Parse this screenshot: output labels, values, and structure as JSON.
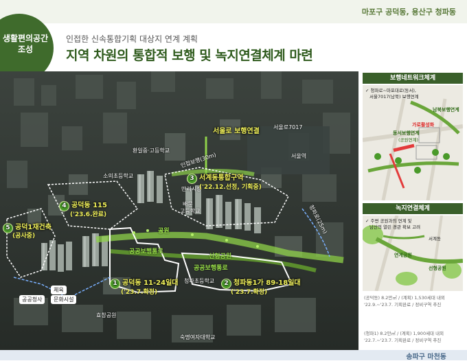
{
  "header": {
    "location": "마포구 공덕동, 용산구 청파동",
    "badge_line1": "생활편의공간",
    "badge_line2": "조성",
    "subtitle": "인접한 신속통합기획 대상지 연계 계획",
    "title": "지역 차원의 통합적 보행 및 녹지연결체계 마련"
  },
  "map": {
    "sites": [
      {
        "num": "1",
        "name": "공덕동 11-24일대",
        "status": "('23.7.확정)"
      },
      {
        "num": "2",
        "name": "청파동1가 89-18일대",
        "status": "('23.7.확정)"
      },
      {
        "num": "3",
        "name": "서계동통합구역",
        "status": "('22.12.선정, 기획중)"
      },
      {
        "num": "4",
        "name": "공덕동 115",
        "status": "('23.6.완료)"
      },
      {
        "num": "5",
        "name": "공덕1재건축",
        "status": "(공사중)"
      }
    ],
    "labels": {
      "seoullo": "서울로 보행연결",
      "seoullo7017": "서울로7017",
      "hwanil": "환일중·고등학교",
      "soeuiChild": "소의초등학교",
      "seoulStation": "서울역",
      "inwalk": "인접보행(30m)",
      "mansuri": "만리시장",
      "bae": "배문",
      "highschool": "고등학교",
      "public_walkway": "공공보행통로",
      "park": "공원",
      "seonhyung_park": "선형공원",
      "public_walkway2": "공공보행통로",
      "cheongpa_road": "청파로(25m)",
      "gongdeok_office": "공공청사",
      "sports": "체육",
      "culture": "문화시설",
      "cheongpa_elem": "청파초등학교",
      "hyochang_park": "효창공원",
      "sookmyung": "숙명여자대학교"
    }
  },
  "panel_walk": {
    "title": "보행네트워크체계",
    "desc_line1": "✓ 청파로~마포대로(동서),",
    "desc_line2": "서울7017(남북) 보행연계",
    "label_north": "남북보행연계",
    "label_street": "가로활성화",
    "label_east": "동서보행연계",
    "label_east_sub": "(공원연계)"
  },
  "panel_green": {
    "title": "녹지연결체계",
    "desc_line1": "✓ 주변 공원과의 연계 및",
    "desc_line2": "남산의 열린 경관 확보 고려",
    "label_park": "연계공원",
    "label_linear": "선형공원",
    "label_yeonghwa": "서계동"
  },
  "stats": {
    "line1": "(공덕동) 8.2만㎡ / (계획) 1,530세대 내외",
    "line2": "'22.9.~'23.7. 기획완료 / 정비구역 추진",
    "line3": "(청파1) 8.2만㎡ / (계획) 1,900세대 내외",
    "line4": "'22.7.~'23.7. 기획완료 / 정비구역 추진"
  },
  "footer": {
    "label": "송파구 마천동"
  },
  "colors": {
    "brand_green": "#3f6b2c",
    "highlight_yellow": "#f2f25a",
    "walk_green": "#7fc43a"
  }
}
